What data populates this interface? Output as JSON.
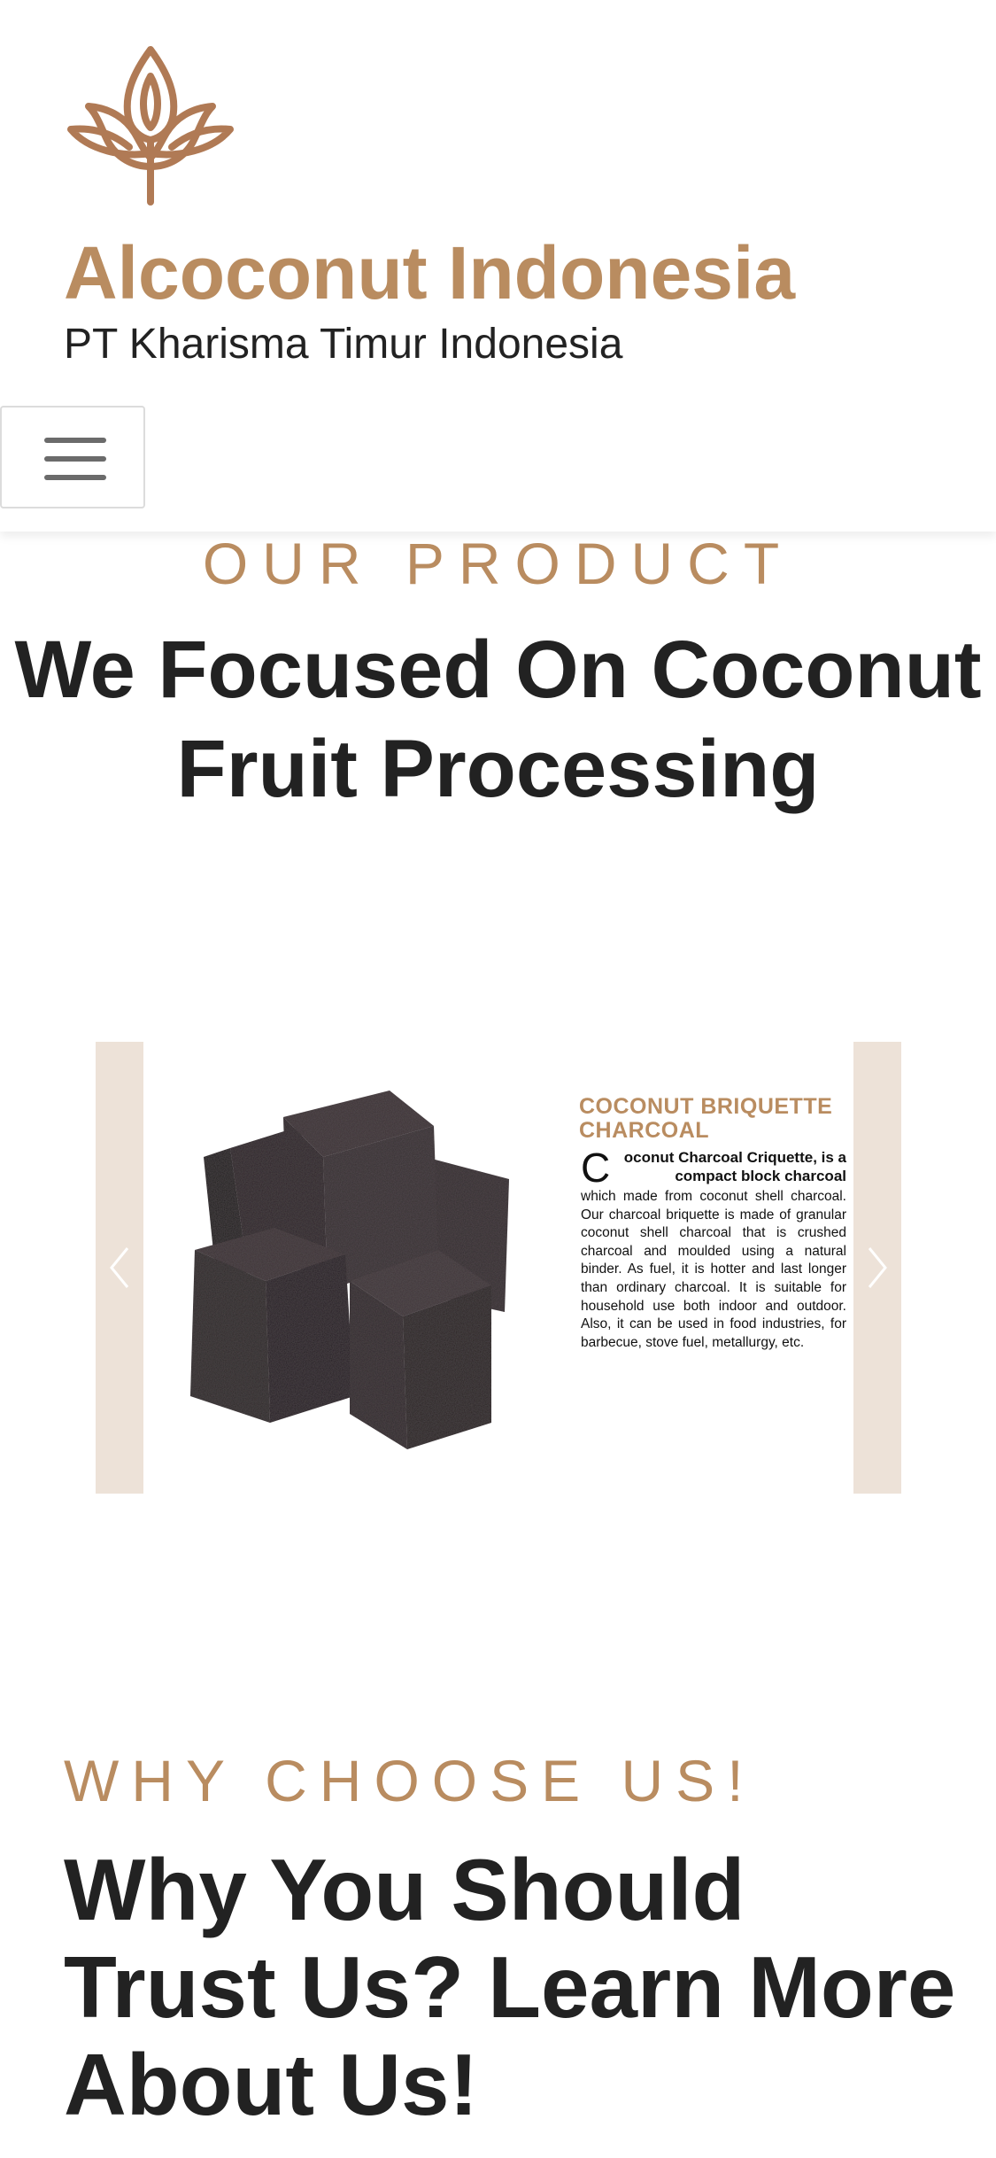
{
  "header": {
    "brand_title": "Alcoconut Indonesia",
    "brand_subtitle": "PT Kharisma Timur Indonesia",
    "logo_icon": "lotus-logo-icon",
    "menu_icon": "hamburger-menu-icon",
    "menu_label": "Toggle navigation"
  },
  "product_section": {
    "eyebrow": "OUR PRODUCT",
    "headline": "We Focused On Coconut Fruit Processing",
    "carousel": {
      "prev_icon": "chevron-left-icon",
      "next_icon": "chevron-right-icon",
      "slide": {
        "image_icon": "charcoal-briquettes-image",
        "title": "COCONUT BRIQUETTE CHARCOAL",
        "lead_initial": "C",
        "lead": "oconut Charcoal Criquette, is a compact block charcoal",
        "body": "which made from coconut shell charcoal. Our charcoal briquette is made of granular coconut shell charcoal that is crushed charcoal and moulded using a natural binder. As fuel, it is hotter and last longer than ordinary charcoal. It is suitable for household use both indoor and outdoor. Also, it can be used in food industries, for barbecue, stove fuel, metallurgy, etc."
      }
    }
  },
  "why_section": {
    "eyebrow": "WHY CHOOSE US!",
    "headline": "Why You Should Trust Us? Learn More About Us!"
  },
  "colors": {
    "accent": "#b98c60",
    "text": "#222222",
    "carousel_bg": "#ede2d8",
    "charcoal": "#2d2528"
  }
}
